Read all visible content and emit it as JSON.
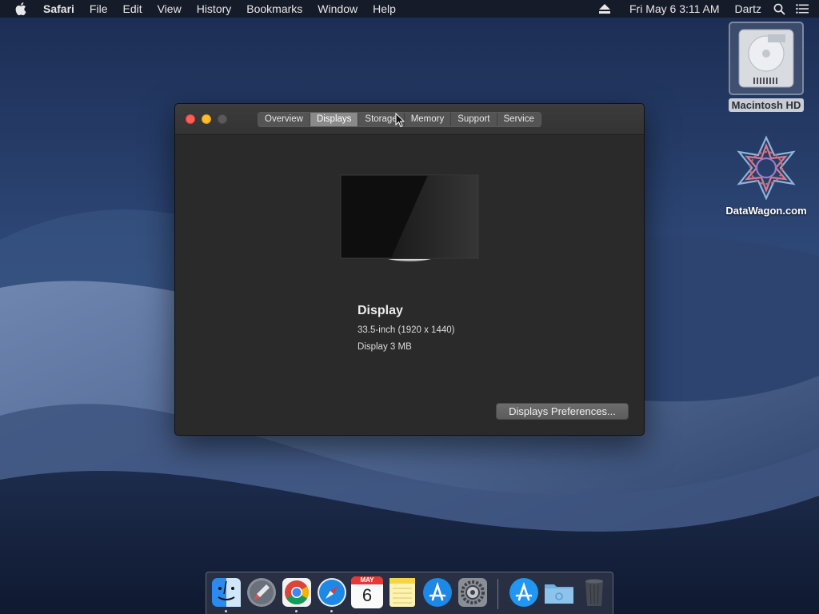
{
  "menubar": {
    "app_name": "Safari",
    "menus": [
      "File",
      "Edit",
      "View",
      "History",
      "Bookmarks",
      "Window",
      "Help"
    ],
    "clock": "Fri May 6  3:11 AM",
    "user": "Dartz",
    "icons": [
      "apple-icon",
      "eject-icon",
      "spotlight-icon",
      "notification-center-icon"
    ]
  },
  "desktop": {
    "hd_label": "Macintosh HD",
    "datawagon_label": "DataWagon.com"
  },
  "window": {
    "tabs": [
      "Overview",
      "Displays",
      "Storage",
      "Memory",
      "Support",
      "Service"
    ],
    "active_tab": "Displays",
    "display": {
      "title": "Display",
      "size": "33.5-inch (1920 x 1440)",
      "memory": "Display 3 MB"
    },
    "prefs_button": "Displays Preferences..."
  },
  "dock": {
    "items": [
      "finder",
      "launchpad",
      "chrome",
      "safari",
      "calendar",
      "notes",
      "app-store",
      "system-preferences",
      "app-store-downloads",
      "documents-folder",
      "trash"
    ],
    "calendar_month": "MAY",
    "calendar_day": "6"
  },
  "colors": {
    "close": "#ff5f57",
    "minimize": "#febc2e",
    "zoom": "#5a5a5a",
    "window_bg": "#2a2a2a"
  }
}
